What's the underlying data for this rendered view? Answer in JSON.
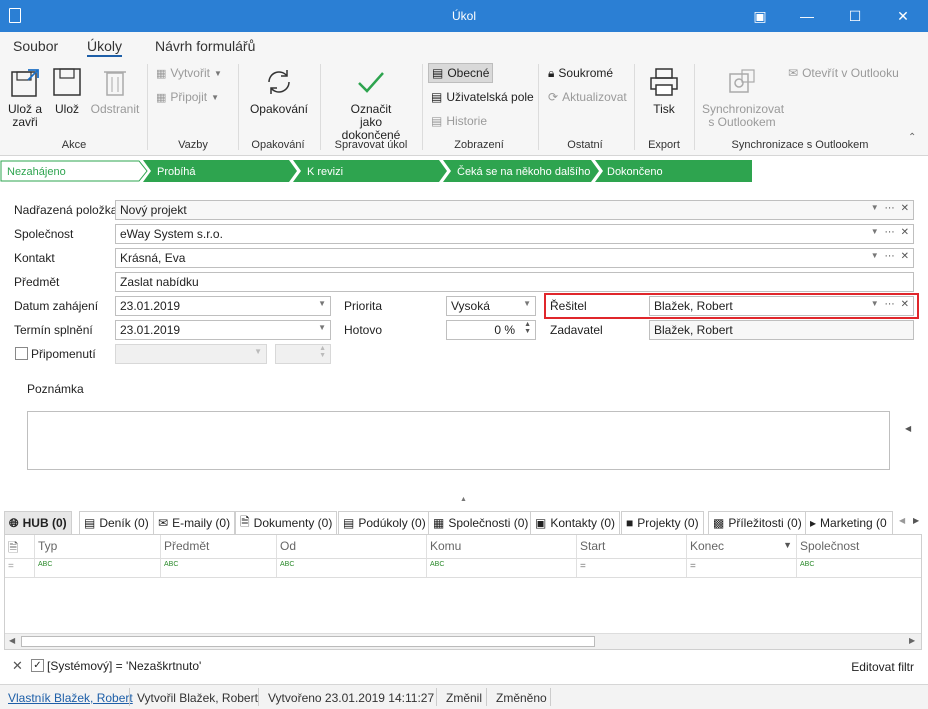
{
  "window": {
    "title": "Úkol"
  },
  "menu": {
    "items": [
      "Soubor",
      "Úkoly",
      "Návrh formulářů"
    ],
    "active": "Úkoly"
  },
  "ribbon": {
    "akce": {
      "group": "Akce",
      "save_close": "Ulož a zavři",
      "save": "Ulož",
      "delete": "Odstranit"
    },
    "vazby": {
      "group": "Vazby",
      "create": "Vytvořit",
      "attach": "Připojit"
    },
    "opakovani": {
      "group": "Opakování",
      "button": "Opakování"
    },
    "spravovat": {
      "group": "Spravovat úkol",
      "button": "Označit jako dokončené"
    },
    "zobrazeni": {
      "group": "Zobrazení",
      "general": "Obecné",
      "user_fields": "Uživatelská pole",
      "history": "Historie"
    },
    "ostatni": {
      "group": "Ostatní",
      "private": "Soukromé",
      "refresh": "Aktualizovat"
    },
    "export": {
      "group": "Export",
      "print": "Tisk"
    },
    "sync": {
      "group": "Synchronizace s Outlookem",
      "sync_button": "Synchronizovat s Outlookem",
      "open_outlook": "Otevřít v Outlooku"
    }
  },
  "stages": [
    "Nezahájeno",
    "Probíhá",
    "K revizi",
    "Čeká se na někoho dalšího",
    "Dokončeno"
  ],
  "stage_active_index": 0,
  "colors": {
    "titlebar": "#2b7fd4",
    "stage_green": "#2ea44f",
    "highlight_red": "#e0262b",
    "accent_blue": "#1e5fa8"
  },
  "form": {
    "parent": {
      "label": "Nadřazená položka",
      "value": "Nový projekt"
    },
    "company": {
      "label": "Společnost",
      "value": "eWay System s.r.o."
    },
    "contact": {
      "label": "Kontakt",
      "value": "Krásná, Eva"
    },
    "subject": {
      "label": "Předmět",
      "value": "Zaslat nabídku"
    },
    "start": {
      "label": "Datum zahájení",
      "value": "23.01.2019"
    },
    "due": {
      "label": "Termín splnění",
      "value": "23.01.2019"
    },
    "reminder": {
      "label": "Připomenutí",
      "checked": false
    },
    "priority": {
      "label": "Priorita",
      "value": "Vysoká"
    },
    "done": {
      "label": "Hotovo",
      "value": "0 %"
    },
    "solver": {
      "label": "Řešitel",
      "value": "Blažek, Robert"
    },
    "requester": {
      "label": "Zadavatel",
      "value": "Blažek, Robert"
    },
    "note": {
      "label": "Poznámka"
    }
  },
  "tabs": [
    {
      "label": "HUB (0)",
      "icon": "globe-icon"
    },
    {
      "label": "Deník (0)",
      "icon": "journal-icon"
    },
    {
      "label": "E-maily (0)",
      "icon": "mail-icon"
    },
    {
      "label": "Dokumenty (0)",
      "icon": "document-icon"
    },
    {
      "label": "Podúkoly (0)",
      "icon": "clipboard-icon"
    },
    {
      "label": "Společnosti (0)",
      "icon": "building-icon"
    },
    {
      "label": "Kontakty (0)",
      "icon": "contact-card-icon"
    },
    {
      "label": "Projekty (0)",
      "icon": "project-icon"
    },
    {
      "label": "Příležitosti (0)",
      "icon": "opportunity-icon"
    },
    {
      "label": "Marketing (0",
      "icon": "megaphone-icon"
    }
  ],
  "grid": {
    "columns": [
      "Typ",
      "Předmět",
      "Od",
      "Komu",
      "Start",
      "Konec",
      "Společnost"
    ],
    "filter_glyph": "ABC"
  },
  "filter_bar": {
    "text": "[Systémový] = 'Nezaškrtnuto'",
    "edit": "Editovat filtr"
  },
  "status": {
    "owner": "Vlastník Blažek, Robert",
    "created_by": "Vytvořil Blažek, Robert",
    "created": "Vytvořeno 23.01.2019 14:11:27",
    "changed": "Změnil",
    "changed_at": "Změněno"
  }
}
